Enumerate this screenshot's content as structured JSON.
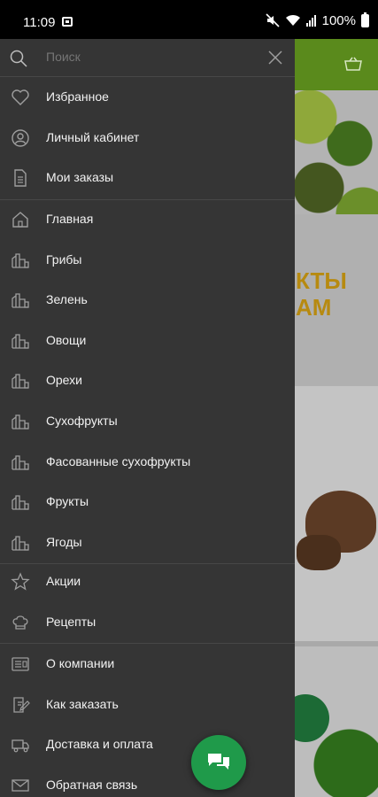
{
  "status_bar": {
    "time": "11:09",
    "battery": "100%"
  },
  "background": {
    "promo_line1": "КТЫ",
    "promo_line2": "АМ",
    "brand_color": "#5a8a1c"
  },
  "drawer": {
    "search": {
      "placeholder": "Поиск"
    },
    "account_items": [
      {
        "label": "Избранное",
        "icon": "heart-icon"
      },
      {
        "label": "Личный кабинет",
        "icon": "account-icon"
      },
      {
        "label": "Мои заказы",
        "icon": "document-icon"
      }
    ],
    "catalog_items": [
      {
        "label": "Главная",
        "icon": "home-icon"
      },
      {
        "label": "Грибы",
        "icon": "category-icon"
      },
      {
        "label": "Зелень",
        "icon": "category-icon"
      },
      {
        "label": "Овощи",
        "icon": "category-icon"
      },
      {
        "label": "Орехи",
        "icon": "category-icon"
      },
      {
        "label": "Сухофрукты",
        "icon": "category-icon"
      },
      {
        "label": "Фасованные сухофрукты",
        "icon": "category-icon"
      },
      {
        "label": "Фрукты",
        "icon": "category-icon"
      },
      {
        "label": "Ягоды",
        "icon": "category-icon"
      }
    ],
    "promo_items": [
      {
        "label": "Акции",
        "icon": "star-icon"
      },
      {
        "label": "Рецепты",
        "icon": "chef-hat-icon"
      }
    ],
    "info_items": [
      {
        "label": "О компании",
        "icon": "company-icon"
      },
      {
        "label": "Как заказать",
        "icon": "order-guide-icon"
      },
      {
        "label": "Доставка и оплата",
        "icon": "delivery-truck-icon"
      },
      {
        "label": "Обратная связь",
        "icon": "mail-icon"
      }
    ]
  },
  "fab": {
    "icon": "chat-icon",
    "color": "#1f9a4a"
  }
}
